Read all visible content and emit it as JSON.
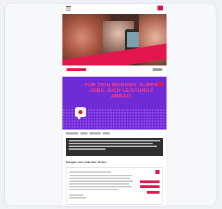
{
  "colors": {
    "accent": "#e3174e",
    "promo_bg": "#6f2bd6",
    "headline": "#ff3f8e",
    "dark_panel": "#2f2f2f"
  },
  "promo": {
    "headline": "FÜR DEIN MORGEN. SUPER JOBS. DICH LEISTUNGS ABBAU."
  },
  "contact": {
    "title": "Beispiel einer aktuellen Stellen"
  },
  "icons": [
    "menu-icon",
    "brand-badge-icon",
    "chat-bubble-icon"
  ]
}
